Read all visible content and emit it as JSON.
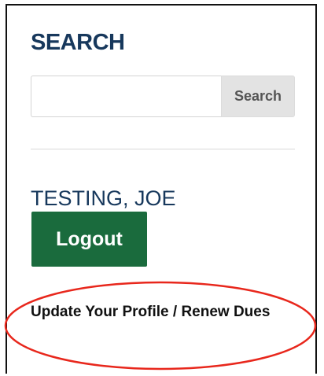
{
  "search": {
    "heading": "SEARCH",
    "input_value": "",
    "button_label": "Search"
  },
  "user": {
    "name": "TESTING, JOE",
    "logout_label": "Logout"
  },
  "links": {
    "profile_renew": "Update Your Profile / Renew Dues"
  },
  "colors": {
    "heading": "#17385c",
    "logout_button": "#1a6b3d",
    "annotation": "#e8271c"
  }
}
